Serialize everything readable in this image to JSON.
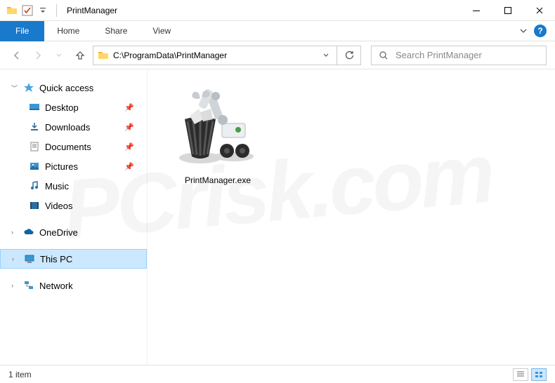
{
  "titlebar": {
    "title": "PrintManager"
  },
  "ribbon": {
    "file": "File",
    "tabs": [
      "Home",
      "Share",
      "View"
    ]
  },
  "nav": {
    "path": "C:\\ProgramData\\PrintManager",
    "search_placeholder": "Search PrintManager"
  },
  "sidebar": {
    "quick_access": "Quick access",
    "items": [
      {
        "label": "Desktop",
        "pinned": true
      },
      {
        "label": "Downloads",
        "pinned": true
      },
      {
        "label": "Documents",
        "pinned": true
      },
      {
        "label": "Pictures",
        "pinned": true
      },
      {
        "label": "Music",
        "pinned": false
      },
      {
        "label": "Videos",
        "pinned": false
      }
    ],
    "onedrive": "OneDrive",
    "this_pc": "This PC",
    "network": "Network"
  },
  "content": {
    "files": [
      {
        "name": "PrintManager.exe"
      }
    ]
  },
  "statusbar": {
    "count": "1 item"
  },
  "colors": {
    "accent": "#1979ca",
    "selection": "#cce8ff"
  }
}
